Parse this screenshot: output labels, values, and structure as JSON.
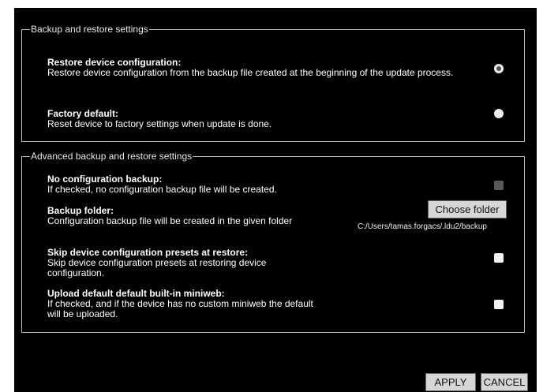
{
  "backup_group": {
    "legend": "Backup and restore settings",
    "restore": {
      "title": "Restore device configuration:",
      "desc": "Restore device configuration from the backup file created at the beginning of the update process.",
      "selected": true
    },
    "factory": {
      "title": "Factory default:",
      "desc": "Reset device to factory settings when update is done.",
      "selected": false
    }
  },
  "advanced_group": {
    "legend": "Advanced backup and restore settings",
    "no_backup": {
      "title": "No configuration backup:",
      "desc": "If checked, no configuration backup file will be created.",
      "checked": false,
      "disabled": true
    },
    "backup_folder": {
      "title": "Backup folder:",
      "desc": "Configuration backup file will be created in the given folder",
      "button": "Choose folder",
      "path": "C:/Users/tamas.forgacs/.ldu2/backup"
    },
    "skip_presets": {
      "title": "Skip device configuration presets at restore:",
      "desc": "Skip device configuration presets at restoring device configuration.",
      "checked": false
    },
    "upload_miniweb": {
      "title": "Upload default default built-in miniweb:",
      "desc": "If checked, and if the device has no custom miniweb the default will be uploaded.",
      "checked": false
    }
  },
  "footer": {
    "apply": "APPLY",
    "cancel": "CANCEL"
  }
}
